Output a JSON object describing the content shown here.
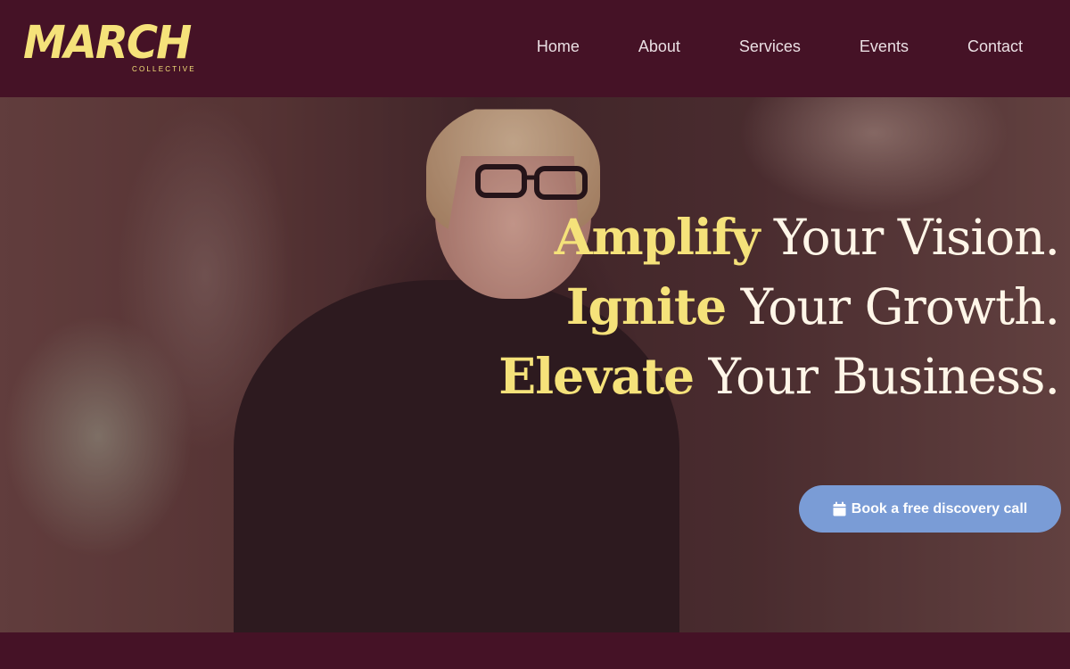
{
  "brand": {
    "name": "MARCH",
    "tagline": "COLLECTIVE"
  },
  "nav": {
    "items": [
      "Home",
      "About",
      "Services",
      "Events",
      "Contact"
    ]
  },
  "hero": {
    "lines": [
      {
        "accent": "Amplify",
        "rest": " Your Vision."
      },
      {
        "accent": "Ignite",
        "rest": " Your Growth."
      },
      {
        "accent": "Elevate",
        "rest": " Your Business."
      }
    ],
    "cta_label": "Book a free discovery call",
    "cta_icon": "calendar-icon"
  },
  "colors": {
    "background": "#451226",
    "accent": "#f5e27a",
    "cta": "#7a9cd6",
    "nav_text": "#eadfe3"
  }
}
